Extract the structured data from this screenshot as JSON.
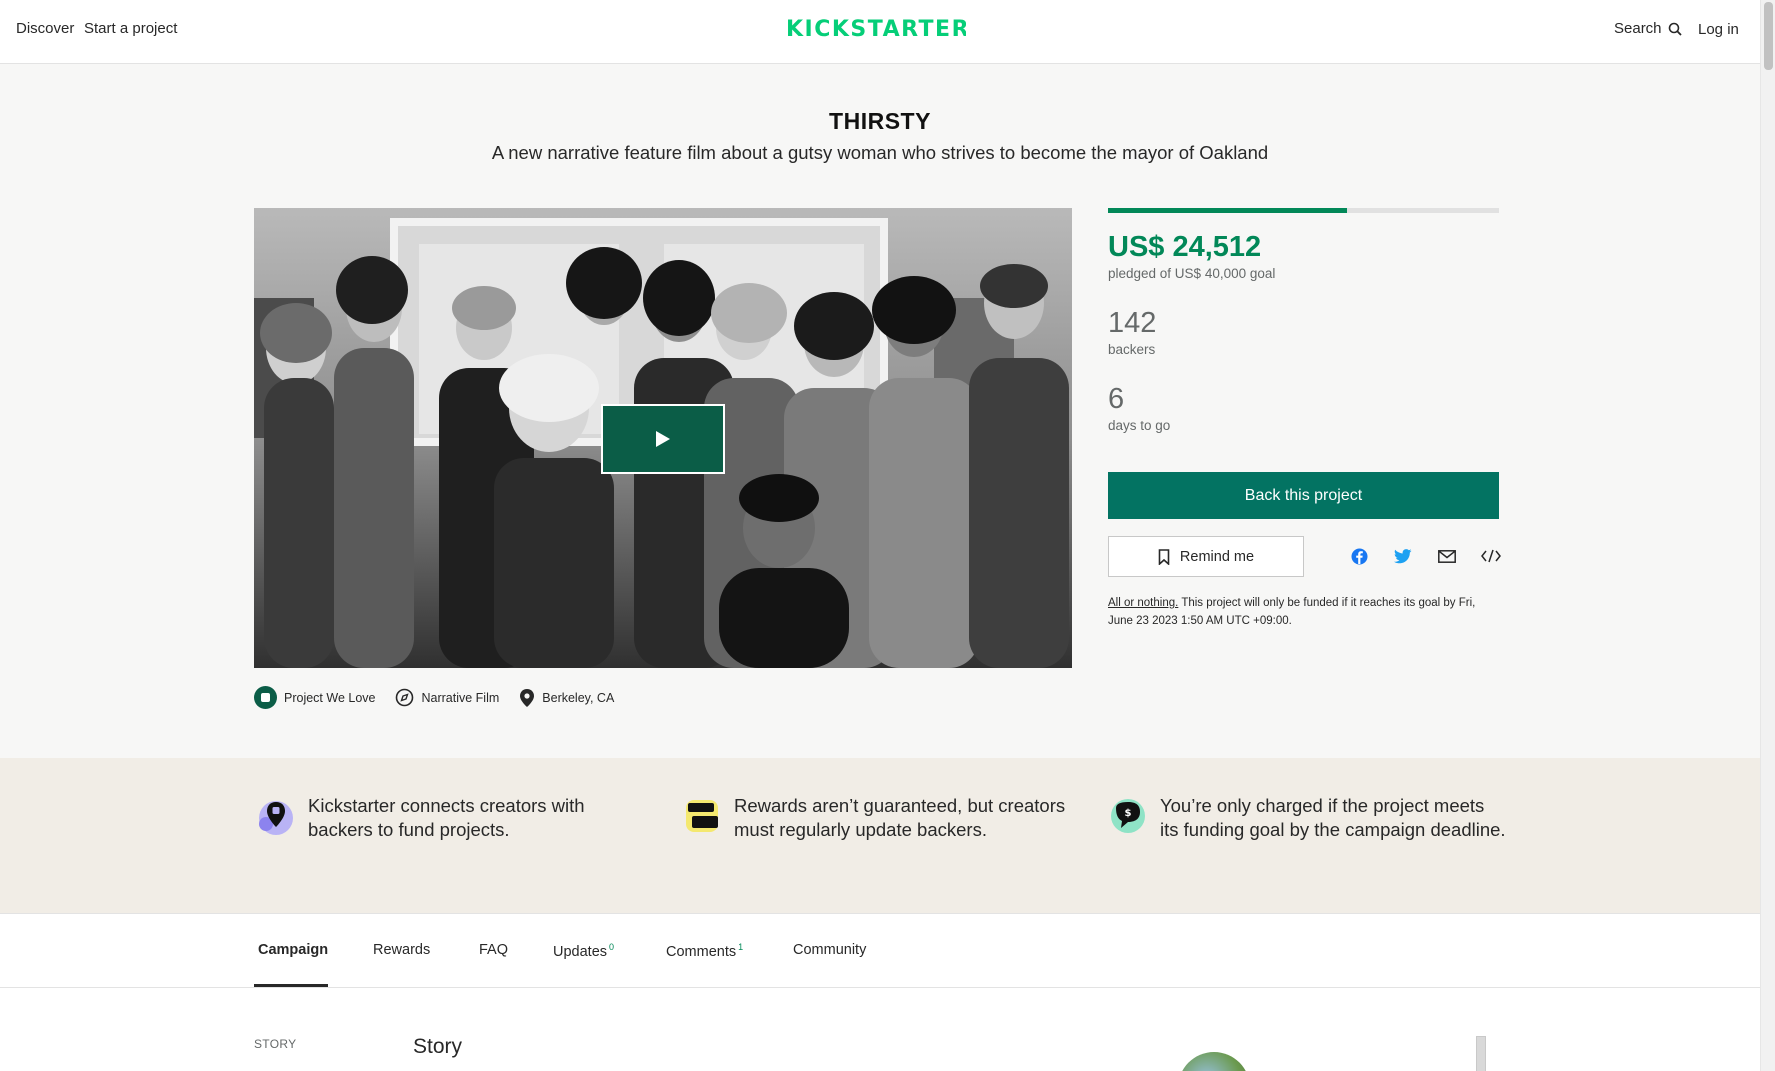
{
  "header": {
    "discover": "Discover",
    "start_project": "Start a project",
    "logo_text": "KICKSTARTER",
    "search": "Search",
    "login": "Log in"
  },
  "project": {
    "title": "THIRSTY",
    "subtitle": "A new narrative feature film about a gutsy woman who strives to become the mayor of Oakland",
    "tags": {
      "pwl": "Project We Love",
      "category": "Narrative Film",
      "location": "Berkeley, CA"
    }
  },
  "stats": {
    "pledged": "US$ 24,512",
    "pledged_sub": "pledged of US$ 40,000 goal",
    "progress_fraction": 0.61,
    "backers": "142",
    "backers_label": "backers",
    "days": "6",
    "days_label": "days to go",
    "back_button": "Back this project",
    "remind_button": "Remind me",
    "aon_link": "All or nothing.",
    "aon_text": " This project will only be funded if it reaches its goal by Fri, June 23 2023 1:50 AM UTC +09:00."
  },
  "band": {
    "item1": "Kickstarter connects creators with backers to fund projects.",
    "item2": "Rewards aren’t guaranteed, but creators must regularly update backers.",
    "item3": "You’re only charged if the project meets its funding goal by the campaign deadline."
  },
  "tabs": {
    "campaign": "Campaign",
    "rewards": "Rewards",
    "faq": "FAQ",
    "updates": "Updates",
    "updates_count": "0",
    "comments": "Comments",
    "comments_count": "1",
    "community": "Community"
  },
  "story": {
    "nav_label": "STORY",
    "heading": "Story"
  },
  "colors": {
    "brand_green": "#05ce78",
    "funded_green": "#028858",
    "button_green": "#037362"
  },
  "icons": [
    "search-icon",
    "play-icon",
    "pwl-badge-icon",
    "compass-icon",
    "location-pin-icon",
    "bookmark-icon",
    "facebook-icon",
    "twitter-icon",
    "email-icon",
    "embed-icon"
  ]
}
